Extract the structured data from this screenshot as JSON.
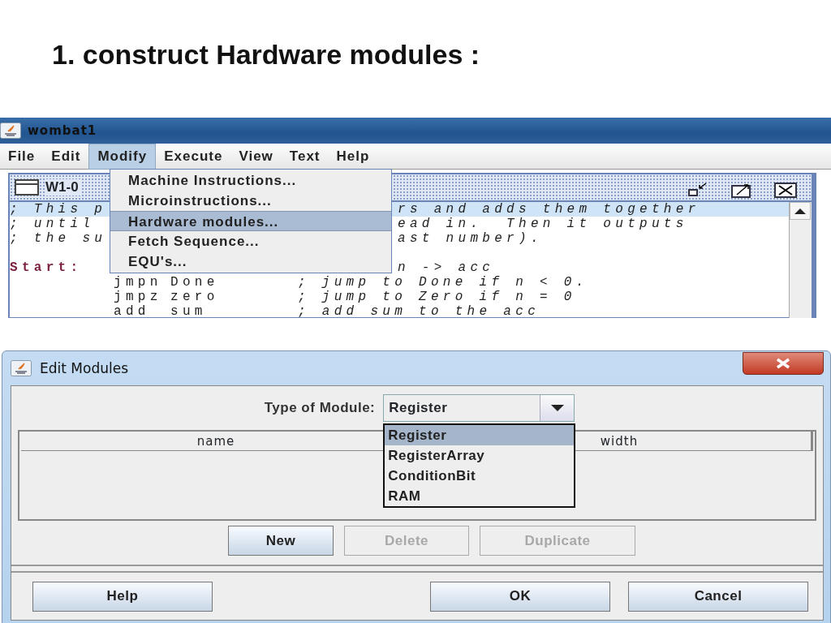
{
  "slide": {
    "title": "1. construct Hardware modules :"
  },
  "main_window": {
    "title": "wombat1",
    "menus": [
      {
        "label": "File",
        "selected": false
      },
      {
        "label": "Edit",
        "selected": false
      },
      {
        "label": "Modify",
        "selected": true
      },
      {
        "label": "Execute",
        "selected": false
      },
      {
        "label": "View",
        "selected": false
      },
      {
        "label": "Text",
        "selected": false
      },
      {
        "label": "Help",
        "selected": false
      }
    ],
    "open_menu": [
      {
        "label": "Machine Instructions...",
        "selected": false
      },
      {
        "label": "Microinstructions...",
        "selected": false
      },
      {
        "label": "Hardware modules...",
        "selected": true
      },
      {
        "label": "Fetch Sequence...",
        "selected": false
      },
      {
        "label": "EQU's...",
        "selected": false
      }
    ],
    "editor": {
      "title": "W1-0",
      "lines": [
        {
          "kind": "split",
          "head": "; This p",
          "tail": "rs and adds them together",
          "current": true
        },
        {
          "kind": "split",
          "head": "; until",
          "tail": "ead in.  Then it outputs",
          "current": false
        },
        {
          "kind": "split",
          "head": "; the su",
          "tail": "ast number).",
          "current": false
        },
        {
          "kind": "blank",
          "current": false
        },
        {
          "kind": "label",
          "head": "Start:",
          "tail": "n -> acc",
          "current": false
        },
        {
          "kind": "code",
          "op": "jmpn",
          "arg": "Done",
          "comment": "; jump to Done if n < 0.",
          "current": false
        },
        {
          "kind": "code",
          "op": "jmpz",
          "arg": "zero",
          "comment": "; jump to Zero if n = 0",
          "current": false
        },
        {
          "kind": "code",
          "op": "add",
          "arg": "sum",
          "comment": "; add sum to the acc",
          "current": false
        }
      ]
    }
  },
  "dialog": {
    "title": "Edit Modules",
    "type_label": "Type of Module:",
    "type_value": "Register",
    "options": [
      {
        "label": "Register",
        "selected": true
      },
      {
        "label": "RegisterArray",
        "selected": false
      },
      {
        "label": "ConditionBit",
        "selected": false
      },
      {
        "label": "RAM",
        "selected": false
      }
    ],
    "columns": [
      "name",
      "width"
    ],
    "buttons": [
      {
        "label": "New",
        "disabled": false
      },
      {
        "label": "Delete",
        "disabled": true
      },
      {
        "label": "Duplicate",
        "disabled": true
      }
    ],
    "footer_buttons": [
      "Help",
      "OK",
      "Cancel"
    ]
  }
}
